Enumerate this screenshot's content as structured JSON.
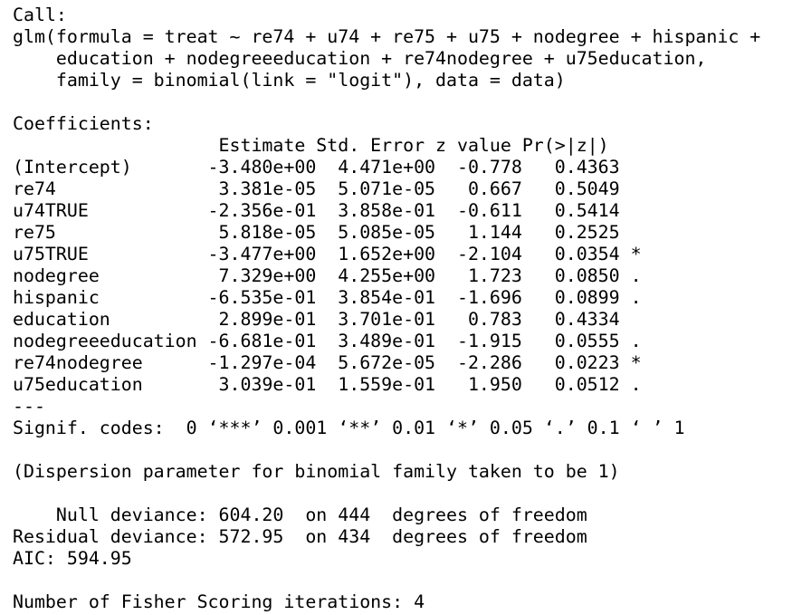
{
  "console": {
    "lines": [
      "Call:",
      "glm(formula = treat ~ re74 + u74 + re75 + u75 + nodegree + hispanic +",
      "    education + nodegreeeducation + re74nodegree + u75education,",
      "    family = binomial(link = \"logit\"), data = data)",
      "",
      "Coefficients:",
      "                   Estimate Std. Error z value Pr(>|z|)",
      "(Intercept)       -3.480e+00  4.471e+00  -0.778   0.4363",
      "re74               3.381e-05  5.071e-05   0.667   0.5049",
      "u74TRUE           -2.356e-01  3.858e-01  -0.611   0.5414",
      "re75               5.818e-05  5.085e-05   1.144   0.2525",
      "u75TRUE           -3.477e+00  1.652e+00  -2.104   0.0354 *",
      "nodegree           7.329e+00  4.255e+00   1.723   0.0850 .",
      "hispanic          -6.535e-01  3.854e-01  -1.696   0.0899 .",
      "education          2.899e-01  3.701e-01   0.783   0.4334",
      "nodegreeeducation -6.681e-01  3.489e-01  -1.915   0.0555 .",
      "re74nodegree      -1.297e-04  5.672e-05  -2.286   0.0223 *",
      "u75education       3.039e-01  1.559e-01   1.950   0.0512 .",
      "---",
      "Signif. codes:  0 ‘***’ 0.001 ‘**’ 0.01 ‘*’ 0.05 ‘.’ 0.1 ‘ ’ 1",
      "",
      "(Dispersion parameter for binomial family taken to be 1)",
      "",
      "    Null deviance: 604.20  on 444  degrees of freedom",
      "Residual deviance: 572.95  on 434  degrees of freedom",
      "AIC: 594.95",
      "",
      "Number of Fisher Scoring iterations: 4"
    ]
  }
}
